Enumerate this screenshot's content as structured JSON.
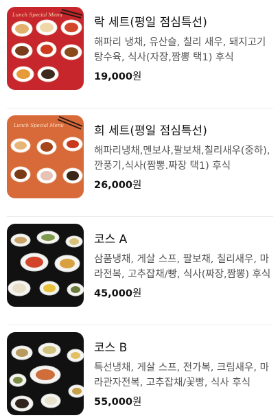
{
  "menu_items": [
    {
      "title": "락 세트(평일 점심특선)",
      "description": "해파리 냉채, 유산슬, 칠리 새우, 돼지고기 탕수육, 식사(자장,짬뽕 택1) 후식",
      "price": "19,000",
      "currency": "원",
      "image_caption": "Lunch Special Menu",
      "image_icon": "lunch-set-photo-icon"
    },
    {
      "title": "희 세트(평일 점심특선)",
      "description": "해파리냉채,멘보샤,팔보채,칠리새우(중하),깐풍기,식사(짬뽕.짜장 택1) 후식",
      "price": "26,000",
      "currency": "원",
      "image_caption": "Lunch Special Menu",
      "image_icon": "lunch-set-photo-icon"
    },
    {
      "title": "코스 A",
      "description": "삼품냉채, 게살 스프, 팔보채, 칠리새우, 마라전복, 고추잡채/빵, 식사(짜장,짬뽕) 후식",
      "price": "45,000",
      "currency": "원",
      "image_icon": "course-dishes-photo-icon"
    },
    {
      "title": "코스 B",
      "description": "특선냉채, 게살 스프, 전가복, 크림새우, 마라관자전복, 고추잡채/꽃빵, 식사 후식",
      "price": "55,000",
      "currency": "원",
      "image_icon": "course-dishes-photo-icon"
    }
  ],
  "colors": {
    "lunch_red": "#c6262c",
    "lunch_orange": "#d86a3a",
    "course_dark": "#111111",
    "price_text": "#111111",
    "desc_text": "#555555"
  }
}
